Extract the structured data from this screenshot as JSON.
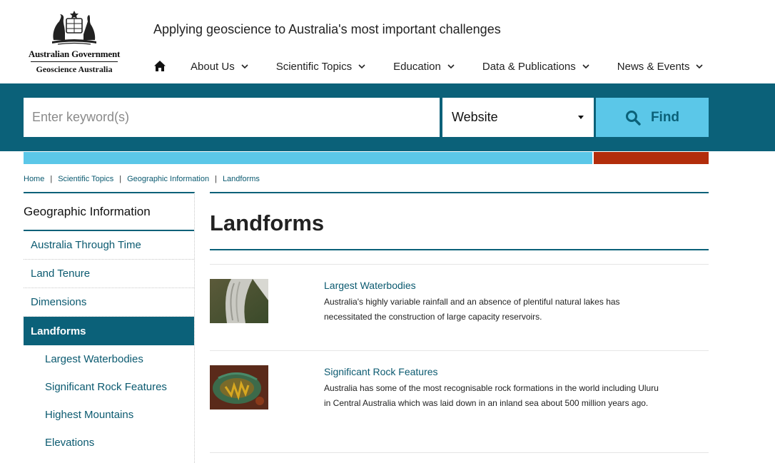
{
  "header": {
    "logo_gov": "Australian Government",
    "logo_agency": "Geoscience Australia",
    "tagline": "Applying geoscience to Australia's most important challenges",
    "nav": [
      {
        "label": "About Us"
      },
      {
        "label": "Scientific Topics"
      },
      {
        "label": "Education"
      },
      {
        "label": "Data & Publications"
      },
      {
        "label": "News & Events"
      }
    ]
  },
  "search": {
    "placeholder": "Enter keyword(s)",
    "value": "",
    "scope_selected": "Website",
    "find_label": "Find"
  },
  "colors": {
    "brand_teal": "#0b6179",
    "accent_blue": "#5bc7e8",
    "accent_red": "#b22d0b",
    "link": "#0b5a70"
  },
  "breadcrumb": [
    "Home",
    "Scientific Topics",
    "Geographic Information",
    "Landforms"
  ],
  "sidebar": {
    "title": "Geographic Information",
    "items": [
      {
        "label": "Australia Through Time"
      },
      {
        "label": "Land Tenure"
      },
      {
        "label": "Dimensions"
      },
      {
        "label": "Landforms",
        "active": true
      }
    ],
    "subitems": [
      {
        "label": "Largest Waterbodies"
      },
      {
        "label": "Significant Rock Features"
      },
      {
        "label": "Highest Mountains"
      },
      {
        "label": "Elevations"
      }
    ]
  },
  "main": {
    "title": "Landforms",
    "entries": [
      {
        "title": "Largest Waterbodies",
        "description": "Australia's highly variable rainfall and an absence of plentiful natural lakes has necessitated the construction of large capacity reservoirs.",
        "thumb_icon": "dam-photo"
      },
      {
        "title": "Significant Rock Features",
        "description": "Australia has some of the most recognisable rock formations in the world including Uluru in Central Australia which was laid down in an inland sea about 500 million years ago.",
        "thumb_icon": "rock-formation-photo"
      }
    ]
  }
}
